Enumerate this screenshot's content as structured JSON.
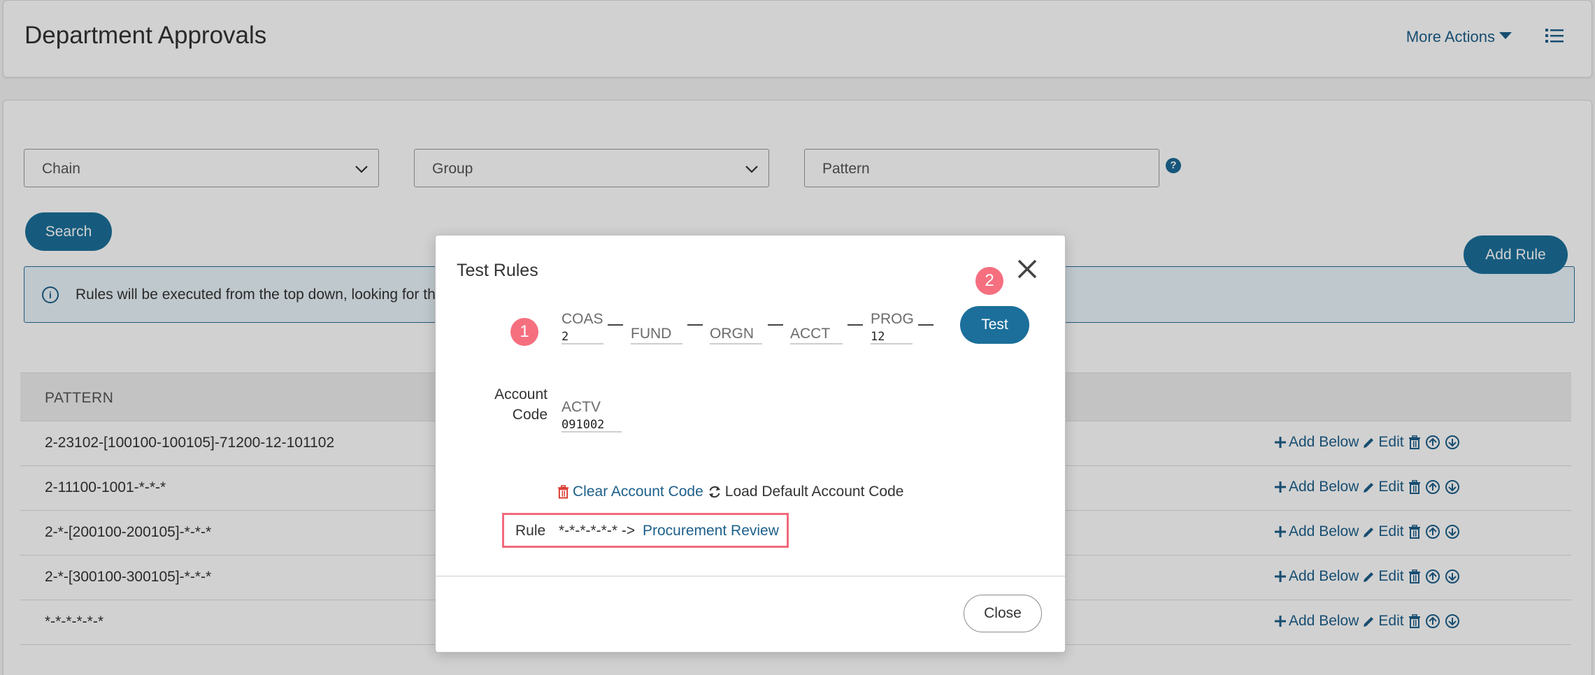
{
  "header": {
    "title": "Department Approvals",
    "more_actions": "More Actions",
    "list_icon": "list-icon"
  },
  "filters": {
    "chain_placeholder": "Chain",
    "group_placeholder": "Group",
    "pattern_placeholder": "Pattern",
    "help_icon": "question-circle-icon",
    "search_label": "Search"
  },
  "info": {
    "text": "Rules will be executed from the top down, looking for th"
  },
  "add_rule_label": "Add Rule",
  "table": {
    "header": "PATTERN",
    "rows": [
      {
        "pattern": "2-23102-[100100-100105]-71200-12-101102"
      },
      {
        "pattern": "2-11100-1001-*-*-*"
      },
      {
        "pattern": "2-*-[200100-200105]-*-*-*"
      },
      {
        "pattern": "2-*-[300100-300105]-*-*-*"
      },
      {
        "pattern": "*-*-*-*-*-*"
      }
    ],
    "actions": {
      "add_below": "Add Below",
      "edit": "Edit"
    }
  },
  "modal": {
    "title": "Test Rules",
    "badge_1": "1",
    "badge_2": "2",
    "test_label": "Test",
    "segments": {
      "coas": {
        "label": "COAS",
        "value": "2"
      },
      "fund": {
        "label": "FUND",
        "value": ""
      },
      "orgn": {
        "label": "ORGN",
        "value": ""
      },
      "acct": {
        "label": "ACCT",
        "value": ""
      },
      "prog": {
        "label": "PROG",
        "value": "12"
      },
      "actv": {
        "label": "ACTV",
        "value": "091002"
      }
    },
    "account_code_label_1": "Account",
    "account_code_label_2": "Code",
    "clear_label": "Clear Account Code",
    "load_label": "Load Default Account Code",
    "rule_label": "Rule",
    "rule_pattern": "*-*-*-*-*-* ->",
    "rule_result": "Procurement Review",
    "close_label": "Close"
  },
  "colors": {
    "accent": "#1b6f9a",
    "link": "#1d5f8a",
    "badge": "#f56f7f",
    "highlight": "#f16a7c",
    "danger": "#d9342b"
  }
}
